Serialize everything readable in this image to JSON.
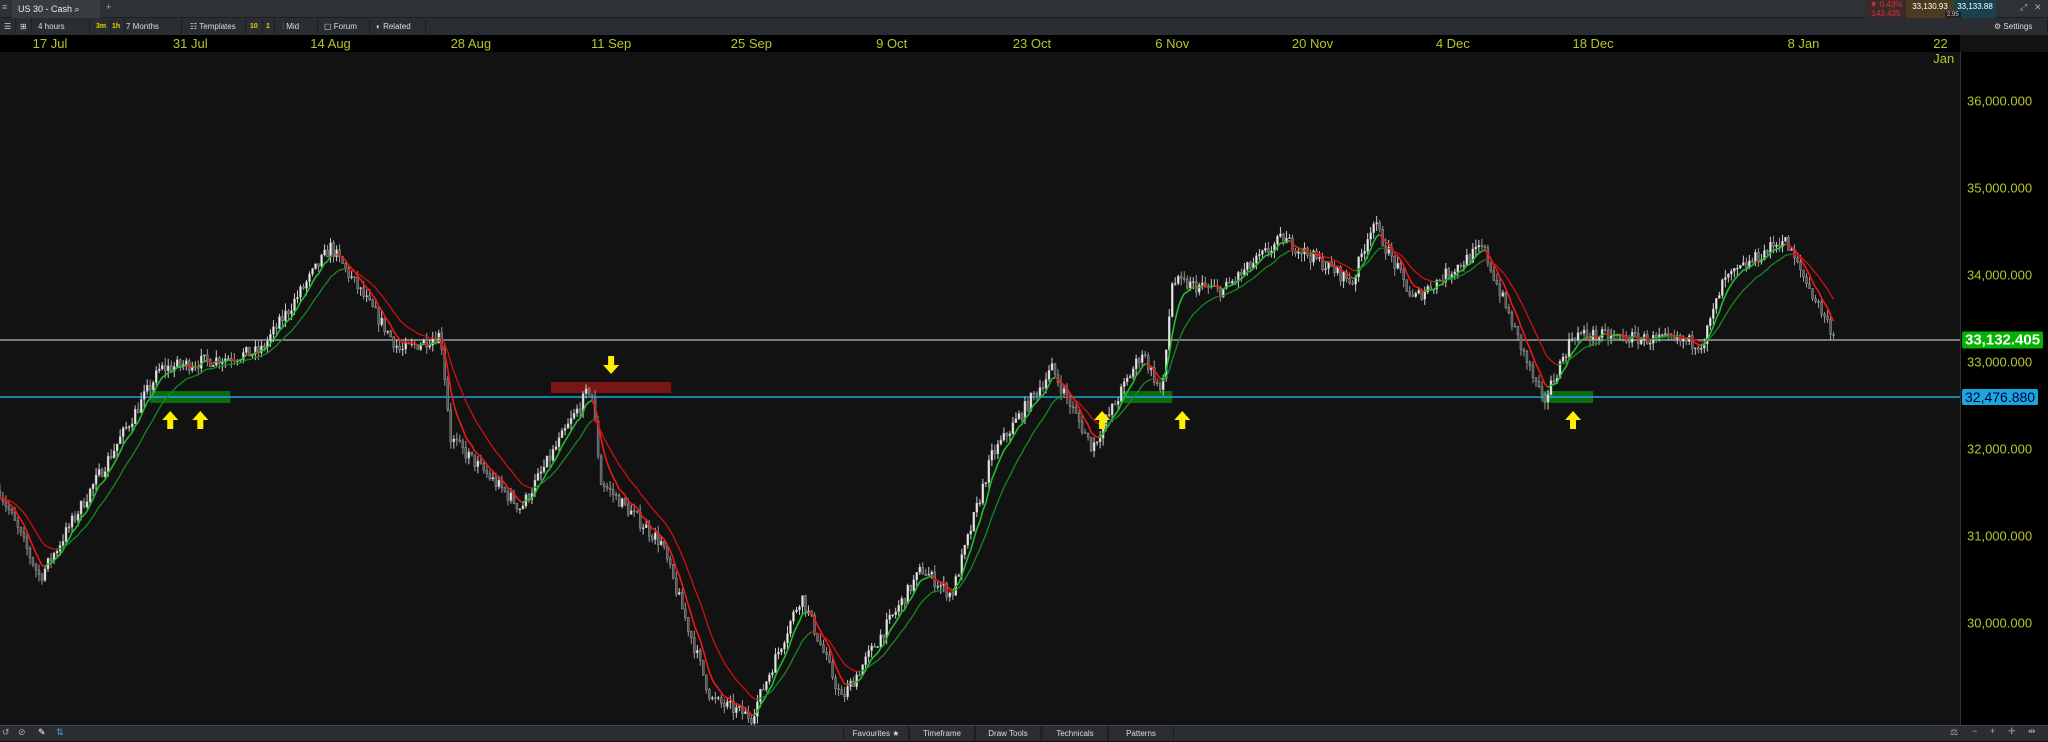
{
  "header": {
    "tab_title": "US 30 - Cash",
    "timeframe": "4 hours",
    "quick_3m": "3m",
    "quick_1h": "1h",
    "range": "7 Months",
    "templates": "Templates",
    "count_10": "10",
    "count_1": "1",
    "price_type": "Mid",
    "forum": "Forum",
    "related": "Related",
    "settings": "Settings"
  },
  "quote": {
    "change_pct": "▼ 0.43%",
    "change_pts": "143.435",
    "bid": "33,130.93",
    "ask": "33,133.88",
    "spread": "2.95",
    "down_color": "#e03030"
  },
  "date_axis": [
    "17 Jul",
    "31 Jul",
    "14 Aug",
    "28 Aug",
    "11 Sep",
    "25 Sep",
    "9 Oct",
    "23 Oct",
    "6 Nov",
    "20 Nov",
    "4 Dec",
    "18 Dec",
    "8 Jan",
    "22 Jan"
  ],
  "price_axis": [
    "36,000.000",
    "35,000.000",
    "34,000.000",
    "33,000.000",
    "32,000.000",
    "31,000.000",
    "30,000.000"
  ],
  "levels": {
    "current": "33,132.405",
    "current_color": "#00b400",
    "support": "32,476.880",
    "support_color": "#1aa7e0"
  },
  "bottom": {
    "favourites": "Favourites",
    "timeframe": "Timeframe",
    "draw_tools": "Draw Tools",
    "technicals": "Technicals",
    "patterns": "Patterns"
  },
  "chart_data": {
    "type": "candlestick",
    "instrument": "US 30 - Cash",
    "interval": "4 hours",
    "price_path": [
      [
        "12 Jul",
        31400
      ],
      [
        "16 Jul",
        30400
      ],
      [
        "25 Jul",
        32200
      ],
      [
        "28 Jul",
        32800
      ],
      [
        "7 Aug",
        33000
      ],
      [
        "14 Aug",
        34200
      ],
      [
        "21 Aug",
        33000
      ],
      [
        "25 Aug",
        33200
      ],
      [
        "26 Aug",
        32000
      ],
      [
        "2 Sep",
        31200
      ],
      [
        "9 Sep",
        32600
      ],
      [
        "10 Sep",
        31500
      ],
      [
        "16 Sep",
        30800
      ],
      [
        "21 Sep",
        29000
      ],
      [
        "25 Sep",
        28800
      ],
      [
        "30 Sep",
        30200
      ],
      [
        "4 Oct",
        29000
      ],
      [
        "12 Oct",
        30500
      ],
      [
        "15 Oct",
        30200
      ],
      [
        "19 Oct",
        31800
      ],
      [
        "25 Oct",
        32800
      ],
      [
        "29 Oct",
        31900
      ],
      [
        "3 Nov",
        33000
      ],
      [
        "5 Nov",
        32500
      ],
      [
        "6 Nov",
        33800
      ],
      [
        "11 Nov",
        33700
      ],
      [
        "17 Nov",
        34300
      ],
      [
        "24 Nov",
        33800
      ],
      [
        "26 Nov",
        34500
      ],
      [
        "30 Nov",
        33600
      ],
      [
        "7 Dec",
        34200
      ],
      [
        "13 Dec",
        32400
      ],
      [
        "16 Dec",
        33200
      ],
      [
        "29 Dec",
        33100
      ],
      [
        "31 Dec",
        33800
      ],
      [
        "6 Jan",
        34300
      ],
      [
        "11 Jan",
        33200
      ]
    ],
    "ylim": [
      29000,
      36500
    ],
    "support_level": 32476.88,
    "current_level": 33132.405,
    "buy_zones": [
      [
        "27 Jul",
        "4 Aug"
      ],
      [
        "1 Nov",
        "6 Nov"
      ],
      [
        "13 Dec",
        "18 Dec"
      ]
    ],
    "sell_zone": [
      "5 Sep",
      "17 Sep"
    ],
    "up_arrows": [
      "29 Jul",
      "1 Aug",
      "30 Oct",
      "7 Nov",
      "16 Dec"
    ],
    "down_arrows": [
      "11 Sep"
    ]
  }
}
